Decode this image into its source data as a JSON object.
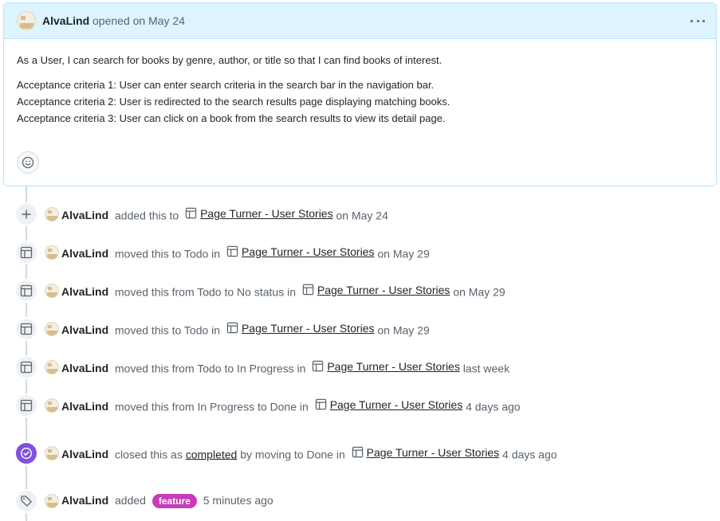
{
  "issue": {
    "author": "AlvaLind",
    "opened_text": "opened on May 24",
    "body_paragraph": "As a User, I can search for books by genre, author, or title so that I can find books of interest.",
    "criteria": [
      "Acceptance criteria 1: User can enter search criteria in the search bar in the navigation bar.",
      "Acceptance criteria 2: User is redirected to the search results page displaying matching books.",
      "Acceptance criteria 3: User can click on a book from the search results to view its detail page."
    ]
  },
  "timeline": {
    "project_name": "Page Turner - User Stories",
    "events": [
      {
        "icon": "plus-icon",
        "author": "AlvaLind",
        "before": "added this to",
        "after": "on May 24"
      },
      {
        "icon": "table-icon",
        "author": "AlvaLind",
        "before": "moved this to Todo in",
        "after": "on May 29"
      },
      {
        "icon": "table-icon",
        "author": "AlvaLind",
        "before": "moved this from Todo to No status in",
        "after": "on May 29"
      },
      {
        "icon": "table-icon",
        "author": "AlvaLind",
        "before": "moved this to Todo in",
        "after": "on May 29"
      },
      {
        "icon": "table-icon",
        "author": "AlvaLind",
        "before": "moved this from Todo to In Progress in",
        "after": "last week"
      },
      {
        "icon": "table-icon",
        "author": "AlvaLind",
        "before": "moved this from In Progress to Done in",
        "after": "4 days ago"
      }
    ],
    "closed_event": {
      "author": "AlvaLind",
      "before": "closed this as",
      "completed_link": "completed",
      "middle": "by moving to Done in",
      "after": "4 days ago"
    },
    "label_event": {
      "author": "AlvaLind",
      "before": "added",
      "label": "feature",
      "label_color": "#c93bb9",
      "after": "5 minutes ago"
    }
  },
  "colors": {
    "header_bg": "#ddf4ff",
    "header_border": "#b6e3ff",
    "closed_badge": "#8250df"
  }
}
